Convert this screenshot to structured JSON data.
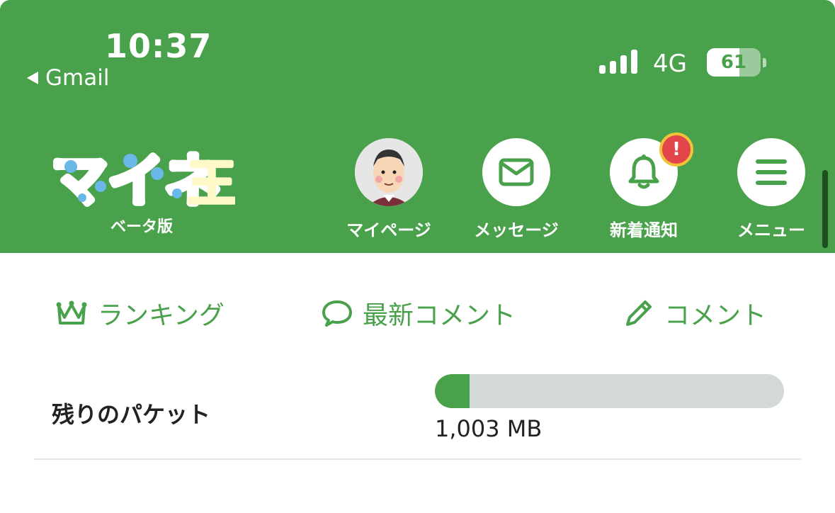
{
  "status_bar": {
    "time": "10:37",
    "back_app": "Gmail",
    "network": "4G",
    "battery": "61",
    "battery_level": 0.61
  },
  "header": {
    "logo_text": "マイネ王",
    "logo_subtitle": "ベータ版",
    "nav": [
      {
        "label": "マイページ",
        "icon": "avatar-icon"
      },
      {
        "label": "メッセージ",
        "icon": "mail-icon"
      },
      {
        "label": "新着通知",
        "icon": "bell-icon",
        "badge": "!"
      },
      {
        "label": "メニュー",
        "icon": "hamburger-menu-icon"
      }
    ]
  },
  "tabs": [
    {
      "label": "ランキング",
      "icon": "crown-icon"
    },
    {
      "label": "最新コメント",
      "icon": "speech-bubble-icon"
    },
    {
      "label": "コメント",
      "icon": "pencil-icon"
    }
  ],
  "packet": {
    "label": "残りのパケット",
    "value": "1,003 MB",
    "fraction": 0.1
  },
  "colors": {
    "brand_green": "#4aa14c",
    "badge_red": "#e2454a",
    "badge_border": "#f2c33a",
    "track_gray": "#d3d9d6"
  }
}
